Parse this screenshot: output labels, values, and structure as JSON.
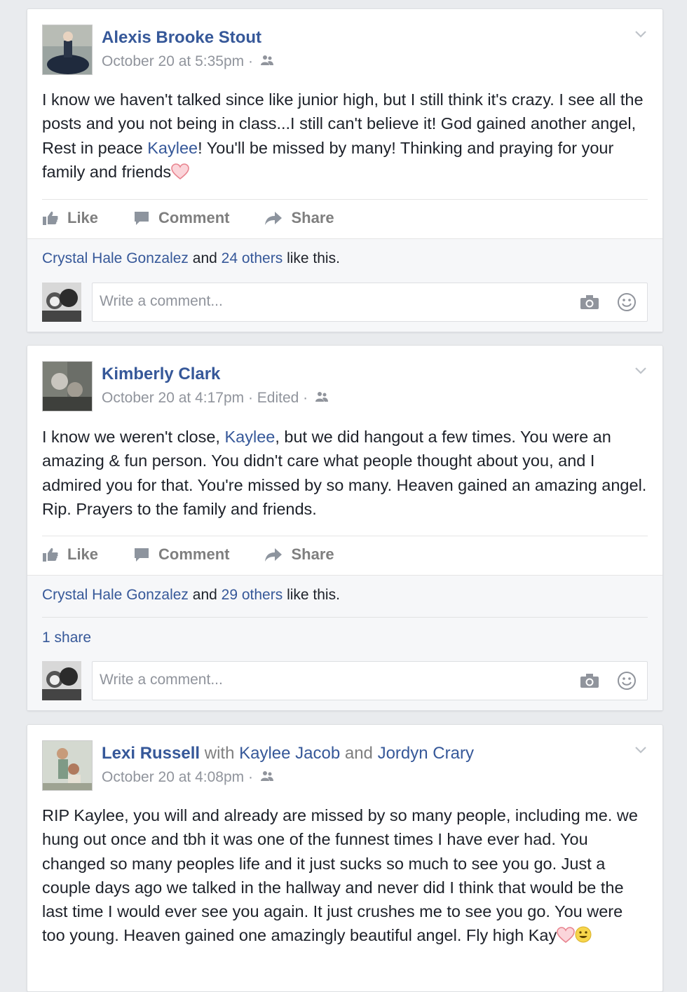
{
  "posts": [
    {
      "author": "Alexis Brooke Stout",
      "meta": "October 20 at 5:35pm ·",
      "text_parts": [
        "I know we haven't talked since like junior high, but I still think it's crazy. I see all the posts and you not being in class...I still can't believe it! God gained another angel, Rest in peace ",
        "Kaylee",
        "! You'll be missed by many! Thinking and praying for your family and friends"
      ],
      "liker": "Crystal Hale Gonzalez",
      "and_word": "and",
      "others": "24 others",
      "like_this": "like this."
    },
    {
      "author": "Kimberly Clark",
      "meta": "October 20 at 4:17pm · Edited ·",
      "text_parts": [
        "I know we weren't close, ",
        "Kaylee",
        ", but we did hangout a few times. You were an amazing & fun person. You didn't care what people thought about you, and I admired you for that. You're missed by so many. Heaven gained an amazing angel. Rip. Prayers to the family and friends."
      ],
      "liker": "Crystal Hale Gonzalez",
      "and_word": "and",
      "others": "29 others",
      "like_this": "like this.",
      "shares": "1 share"
    },
    {
      "author": "Lexi Russell",
      "with_word": "with",
      "tag1": "Kaylee Jacob",
      "and_word": "and",
      "tag2": "Jordyn Crary",
      "meta": "October 20 at 4:08pm ·",
      "text": "RIP Kaylee, you will and already are missed by so many people, including me. we hung out once and tbh it was one of the funnest times I have ever had. You changed so many peoples life and it just sucks so much to see you go. Just a couple days ago we talked in the hallway and never did I think that would be the last time I would ever see you again. It just crushes me to see you go. You were too young. Heaven gained one amazingly beautiful angel. Fly high Kay"
    }
  ],
  "actions": {
    "like": "Like",
    "comment": "Comment",
    "share": "Share"
  },
  "comment_placeholder": "Write a comment...",
  "colors": {
    "link": "#365899",
    "muted": "#90949c",
    "heart": "#f0a0a8",
    "background": "#e9ebee"
  },
  "icons": [
    "audience-icon",
    "chevron-down-icon",
    "like-icon",
    "comment-icon",
    "share-icon",
    "camera-icon",
    "smiley-icon",
    "heart-emoji",
    "smile-emoji"
  ]
}
